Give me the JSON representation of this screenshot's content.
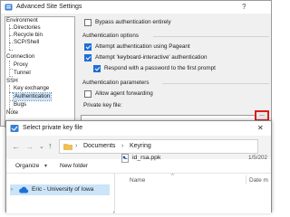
{
  "settings_window": {
    "title": "Advanced Site Settings",
    "help_button": "?",
    "tree": [
      {
        "label": "Environment"
      },
      {
        "label": "Directories"
      },
      {
        "label": "Recycle bin"
      },
      {
        "label": "SCP/Shell"
      },
      {
        "label": "Connection"
      },
      {
        "label": "Proxy"
      },
      {
        "label": "Tunnel"
      },
      {
        "label": "SSH"
      },
      {
        "label": "Key exchange"
      },
      {
        "label": "Authentication"
      },
      {
        "label": "Bugs"
      },
      {
        "label": "Note"
      }
    ],
    "bypass_auth": {
      "label": "Bypass authentication entirely",
      "checked": false
    },
    "auth_options_heading": "Authentication options",
    "pageant": {
      "label": "Attempt authentication using Pageant",
      "checked": true
    },
    "keyboard_interactive": {
      "label": "Attempt 'keyboard-interactive' authentication",
      "checked": true
    },
    "respond_password": {
      "label": "Respond with a password to the first prompt",
      "checked": true
    },
    "auth_params_heading": "Authentication parameters",
    "agent_forwarding": {
      "label": "Allow agent forwarding",
      "checked": false
    },
    "private_key_label": "Private key file:",
    "browse_button": "..."
  },
  "file_dialog": {
    "title": "Select private key file",
    "close_button": "✕",
    "breadcrumb": [
      "Documents",
      "Keyring"
    ],
    "organize_button": "Organize",
    "new_folder_button": "New folder",
    "nav_item": "Eric - University of Iowa",
    "columns": {
      "name": "Name",
      "date": "Date m"
    },
    "files": [
      {
        "name": "id_rsa.ppk",
        "date": "1/5/202"
      }
    ]
  },
  "colors": {
    "accent": "#1e6fd6",
    "highlight": "#e01b1b",
    "selection": "#cce4f7"
  }
}
